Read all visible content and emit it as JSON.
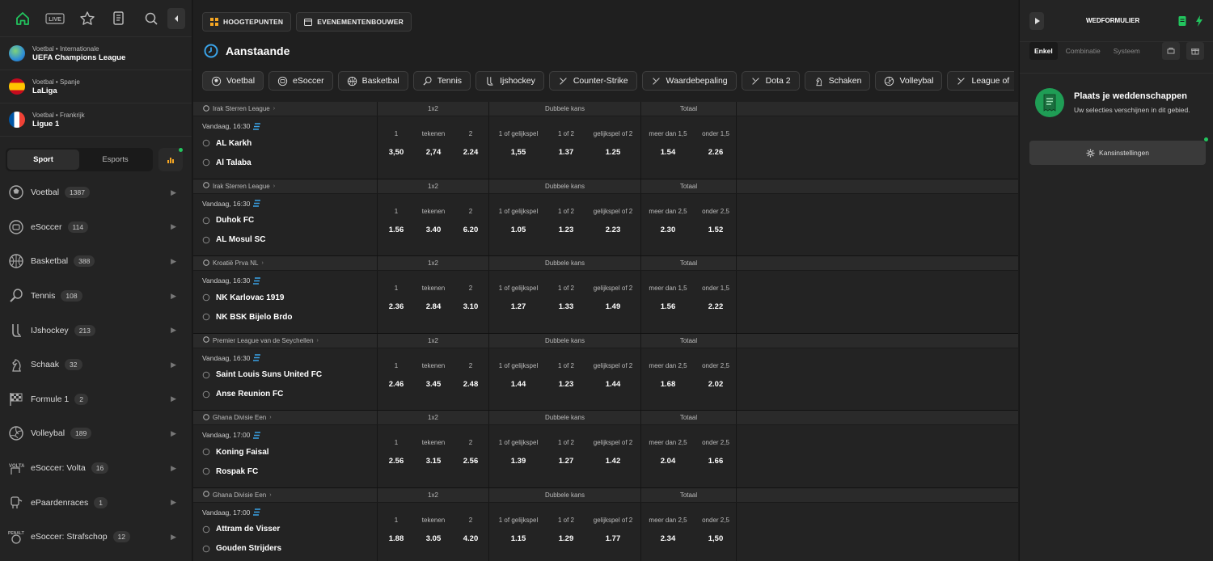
{
  "sidebar": {
    "topnav": [
      "home-icon",
      "live-icon",
      "star-icon",
      "document-icon",
      "search-icon"
    ],
    "live_label": "LIVE",
    "leagues": [
      {
        "meta": "Voetbal • Internationale",
        "name": "UEFA Champions League",
        "flag": "globe"
      },
      {
        "meta": "Voetbal • Spanje",
        "name": "LaLiga",
        "flag": "spain"
      },
      {
        "meta": "Voetbal • Frankrijk",
        "name": "Ligue 1",
        "flag": "france"
      }
    ],
    "toggle": {
      "sport": "Sport",
      "esports": "Esports"
    },
    "sports": [
      {
        "label": "Voetbal",
        "count": "1387",
        "icon": "soccer-ball-icon"
      },
      {
        "label": "eSoccer",
        "count": "114",
        "icon": "esoccer-icon"
      },
      {
        "label": "Basketbal",
        "count": "388",
        "icon": "basketball-icon"
      },
      {
        "label": "Tennis",
        "count": "108",
        "icon": "tennis-icon"
      },
      {
        "label": "IJshockey",
        "count": "213",
        "icon": "hockey-icon"
      },
      {
        "label": "Schaak",
        "count": "32",
        "icon": "chess-icon"
      },
      {
        "label": "Formule 1",
        "count": "2",
        "icon": "checkered-flag-icon"
      },
      {
        "label": "Volleybal",
        "count": "189",
        "icon": "volleyball-icon"
      },
      {
        "label": "eSoccer: Volta",
        "count": "16",
        "icon": "volta-icon"
      },
      {
        "label": "ePaardenraces",
        "count": "1",
        "icon": "horse-icon"
      },
      {
        "label": "eSoccer: Strafschop",
        "count": "12",
        "icon": "penalty-icon"
      }
    ]
  },
  "main": {
    "top_buttons": [
      "HOOGTEPUNTEN",
      "EVENEMENTENBOUWER"
    ],
    "heading": "Aanstaande",
    "chips": [
      "Voetbal",
      "eSoccer",
      "Basketbal",
      "Tennis",
      "Ijshockey",
      "Counter-Strike",
      "Waardebepaling",
      "Dota 2",
      "Schaken",
      "Volleybal",
      "League of"
    ],
    "group_headers": {
      "g1": "1x2",
      "g2": "Dubbele kans",
      "g3": "Totaal"
    },
    "events": [
      {
        "league": "Irak Sterren League",
        "time": "Vandaag, 16:30",
        "home": "AL Karkh",
        "away": "Al Talaba",
        "labels": [
          "1",
          "tekenen",
          "2",
          "1 of gelijkspel",
          "1 of 2",
          "gelijkspel of 2",
          "meer dan 1,5",
          "onder 1,5"
        ],
        "odds": [
          "3,50",
          "2,74",
          "2.24",
          "1,55",
          "1.37",
          "1.25",
          "1.54",
          "2.26"
        ]
      },
      {
        "league": "Irak Sterren League",
        "time": "Vandaag, 16:30",
        "home": "Duhok FC",
        "away": "AL Mosul SC",
        "labels": [
          "1",
          "tekenen",
          "2",
          "1 of gelijkspel",
          "1 of 2",
          "gelijkspel of 2",
          "meer dan 2,5",
          "onder 2,5"
        ],
        "odds": [
          "1.56",
          "3.40",
          "6.20",
          "1.05",
          "1.23",
          "2.23",
          "2.30",
          "1.52"
        ]
      },
      {
        "league": "Kroatië Prva NL",
        "time": "Vandaag, 16:30",
        "home": "NK Karlovac 1919",
        "away": "NK BSK Bijelo Brdo",
        "labels": [
          "1",
          "tekenen",
          "2",
          "1 of gelijkspel",
          "1 of 2",
          "gelijkspel of 2",
          "meer dan 1,5",
          "onder 1,5"
        ],
        "odds": [
          "2.36",
          "2.84",
          "3.10",
          "1.27",
          "1.33",
          "1.49",
          "1.56",
          "2.22"
        ]
      },
      {
        "league": "Premier League van de Seychellen",
        "time": "Vandaag, 16:30",
        "home": "Saint Louis Suns United FC",
        "away": "Anse Reunion FC",
        "labels": [
          "1",
          "tekenen",
          "2",
          "1 of gelijkspel",
          "1 of 2",
          "gelijkspel of 2",
          "meer dan 2,5",
          "onder 2,5"
        ],
        "odds": [
          "2.46",
          "3.45",
          "2.48",
          "1.44",
          "1.23",
          "1.44",
          "1.68",
          "2.02"
        ]
      },
      {
        "league": "Ghana Divisie Een",
        "time": "Vandaag, 17:00",
        "home": "Koning Faisal",
        "away": "Rospak FC",
        "labels": [
          "1",
          "tekenen",
          "2",
          "1 of gelijkspel",
          "1 of 2",
          "gelijkspel of 2",
          "meer dan 2,5",
          "onder 2,5"
        ],
        "odds": [
          "2.56",
          "3.15",
          "2.56",
          "1.39",
          "1.27",
          "1.42",
          "2.04",
          "1.66"
        ]
      },
      {
        "league": "Ghana Divisie Een",
        "time": "Vandaag, 17:00",
        "home": "Attram de Visser",
        "away": "Gouden Strijders",
        "labels": [
          "1",
          "tekenen",
          "2",
          "1 of gelijkspel",
          "1 of 2",
          "gelijkspel of 2",
          "meer dan 2,5",
          "onder 2,5"
        ],
        "odds": [
          "1.88",
          "3.05",
          "4.20",
          "1.15",
          "1.29",
          "1.77",
          "2.34",
          "1,50"
        ]
      }
    ]
  },
  "betslip": {
    "title": "WEDFORMULIER",
    "tabs": [
      "Enkel",
      "Combinatie",
      "Systeem"
    ],
    "empty_title": "Plaats je weddenschappen",
    "empty_sub": "Uw selecties verschijnen in dit gebied.",
    "odds_settings": "Kansinstellingen"
  },
  "colors": {
    "accent": "#22c55e",
    "bg": "#1f1f1f",
    "sidebar": "#232323",
    "betslip_badge": "#1f9d55"
  }
}
